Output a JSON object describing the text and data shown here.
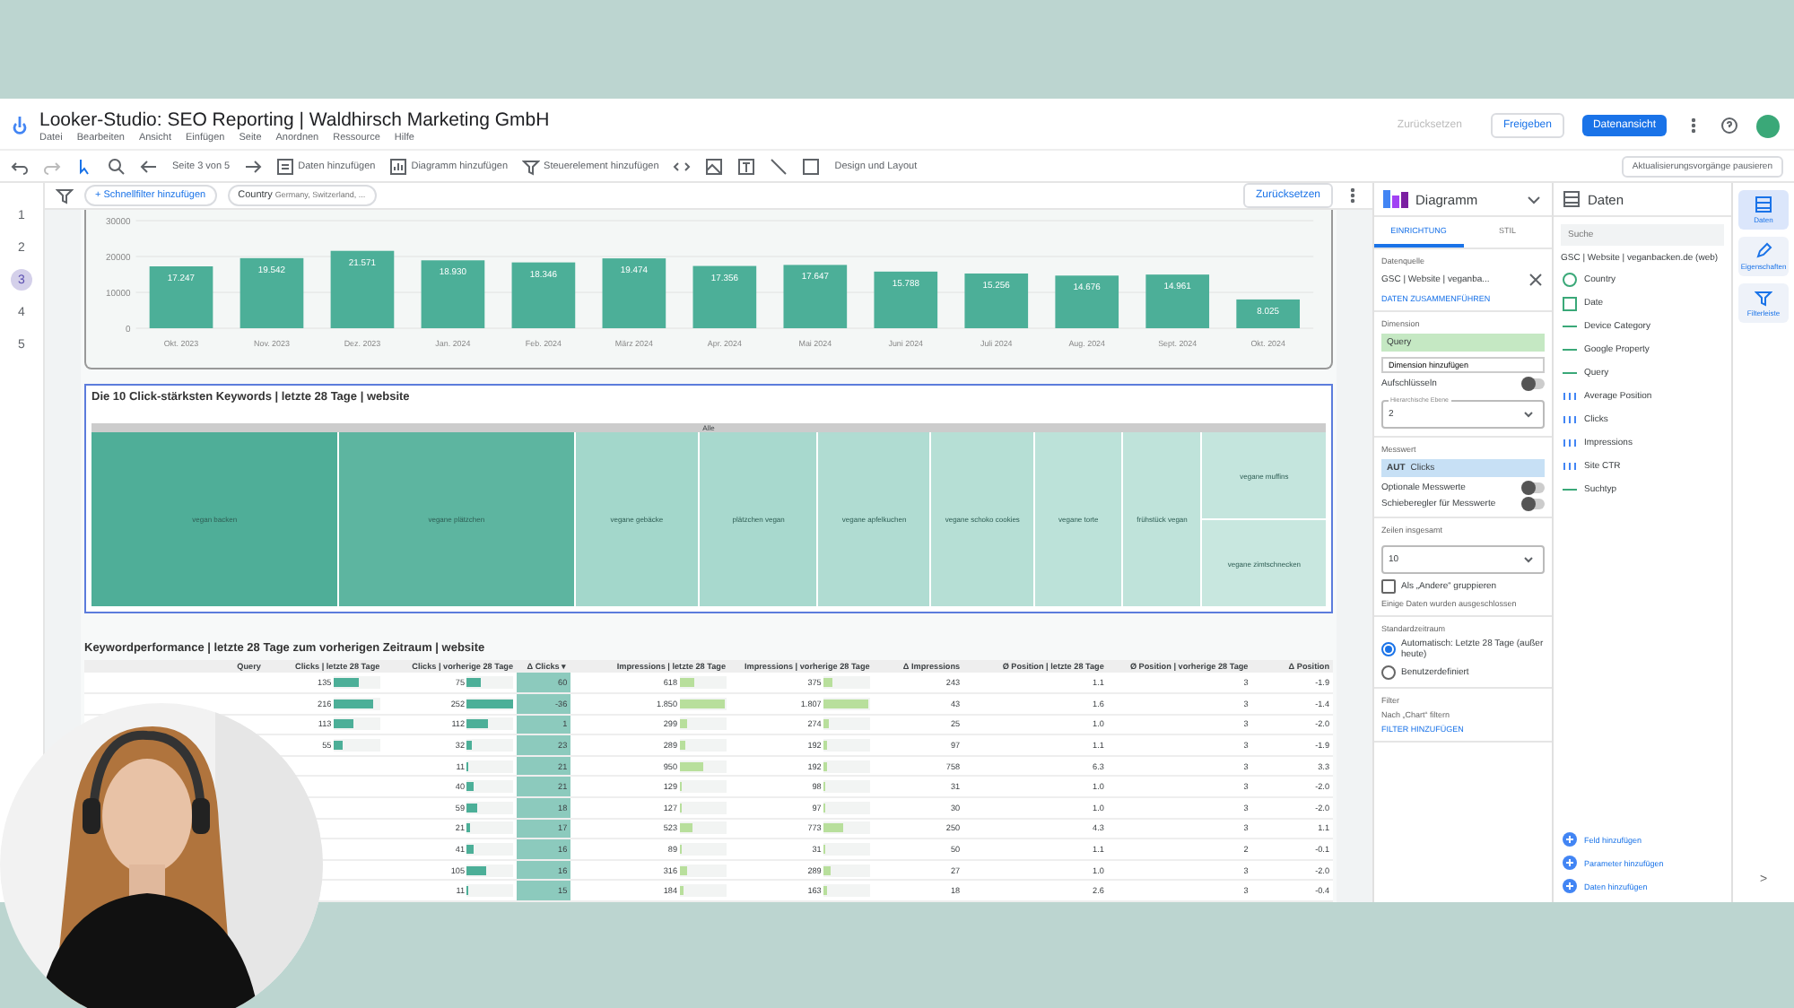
{
  "header": {
    "title": "Looker-Studio: SEO Reporting | Waldhirsch Marketing GmbH",
    "menu": [
      "Datei",
      "Bearbeiten",
      "Ansicht",
      "Einfügen",
      "Seite",
      "Anordnen",
      "Ressource",
      "Hilfe"
    ],
    "reset_button": {
      "label": "Zurücksetzen",
      "disabled": true
    },
    "share_button": "Freigeben",
    "view_button": "Datenansicht"
  },
  "toolbar": {
    "page_indicator": "Seite 3 von 5",
    "items": [
      {
        "label": "Daten hinzufügen",
        "kind": "data"
      },
      {
        "label": "Diagramm hinzufügen",
        "kind": "chart"
      },
      {
        "label": "Steuerelement hinzufügen",
        "kind": "control"
      }
    ],
    "theme_button": "Design und Layout",
    "pause_button": "Aktualisierungsvorgänge pausieren"
  },
  "pages": [
    {
      "label": "1",
      "selected": false
    },
    {
      "label": "2",
      "selected": false
    },
    {
      "label": "3",
      "selected": true
    },
    {
      "label": "4",
      "selected": false
    },
    {
      "label": "5",
      "selected": false
    }
  ],
  "filter_bar": {
    "add_filter": "+ Schnellfilter hinzufügen",
    "chip": {
      "label": "Country",
      "value": "Germany, Switzerland, ..."
    },
    "reset": "Zurücksetzen"
  },
  "bar_chart": {
    "chart_data": {
      "type": "bar",
      "categories": [
        "Okt. 2023",
        "Nov. 2023",
        "Dez. 2023",
        "Jan. 2024",
        "Feb. 2024",
        "März 2024",
        "Apr. 2024",
        "Mai 2024",
        "Juni 2024",
        "Juli 2024",
        "Aug. 2024",
        "Sept. 2024",
        "Okt. 2024"
      ],
      "series": [
        {
          "color": "#4caf98",
          "values": [
            17247,
            19542,
            21571,
            18930,
            18346,
            19474,
            17356,
            17647,
            15788,
            15256,
            14676,
            14961,
            8025
          ]
        }
      ],
      "value_labels": [
        "17.247",
        "19.542",
        "21.571",
        "18.930",
        "18.346",
        "19.474",
        "17.356",
        "17.647",
        "15.788",
        "15.256",
        "14.676",
        "14.961",
        "8.025"
      ],
      "ylim": [
        0,
        30000
      ],
      "yticks": [
        0,
        10000,
        20000,
        30000
      ]
    }
  },
  "treemap": {
    "title": "Die 10 Click-stärksten Keywords | letzte 28 Tage | website",
    "root": "Alle",
    "cells": [
      {
        "label": "vegan backen",
        "color": "#4fae98"
      },
      {
        "label": "vegane plätzchen",
        "color": "#5db5a0"
      },
      {
        "label": "vegane gebäcke",
        "color": "#a3d7cb"
      },
      {
        "label": "plätzchen vegan",
        "color": "#a8d9ce"
      },
      {
        "label": "vegane apfelkuchen",
        "color": "#b0dcd2"
      },
      {
        "label": "vegane schoko cookies",
        "color": "#b6dfd5"
      },
      {
        "label": "vegane torte",
        "color": "#bce2d9"
      },
      {
        "label": "frühstück vegan",
        "color": "#bfe3da"
      },
      {
        "label": "vegane muffins",
        "color": "#c4e5dd"
      },
      {
        "label": "vegane zimtschnecken",
        "color": "#c8e7df"
      }
    ]
  },
  "table": {
    "title": "Keywordperformance | letzte 28 Tage zum vorherigen Zeitraum | website",
    "columns": [
      "Query",
      "Clicks | letzte 28 Tage",
      "Clicks | vorherige 28 Tage",
      "Δ Clicks ▾",
      "Impressions | letzte 28 Tage",
      "Impressions | vorherige 28 Tage",
      "Δ Impressions",
      "Ø Position | letzte 28 Tage",
      "Ø Position | vorherige 28 Tage",
      "Δ Position"
    ],
    "rows": [
      [
        null,
        {
          "text": "135",
          "level": 0.54
        },
        {
          "text": "75",
          "level": 0.3
        },
        "60",
        {
          "text": "618",
          "level": 0.33
        },
        {
          "text": "375",
          "level": 0.2
        },
        "243",
        "1.1",
        "3",
        "-1.9"
      ],
      [
        null,
        {
          "text": "216",
          "level": 0.86
        },
        {
          "text": "252",
          "level": 1
        },
        "-36",
        {
          "text": "1.850",
          "level": 0.97
        },
        {
          "text": "1.807",
          "level": 0.95
        },
        "43",
        "1.6",
        "3",
        "-1.4"
      ],
      [
        null,
        {
          "text": "113",
          "level": 0.45
        },
        {
          "text": "112",
          "level": 0.45
        },
        "1",
        {
          "text": "299",
          "level": 0.16
        },
        {
          "text": "274",
          "level": 0.14
        },
        "25",
        "1.0",
        "3",
        "-2.0"
      ],
      [
        null,
        {
          "text": "55",
          "level": 0.22
        },
        {
          "text": "32",
          "level": 0.13
        },
        "23",
        {
          "text": "289",
          "level": 0.15
        },
        {
          "text": "192",
          "level": 0.1
        },
        "97",
        "1.1",
        "3",
        "-1.9"
      ],
      [
        null,
        null,
        {
          "text": "11",
          "level": 0.04
        },
        "21",
        {
          "text": "950",
          "level": 0.5
        },
        {
          "text": "192",
          "level": 0.1
        },
        "758",
        "6.3",
        "3",
        "3.3"
      ],
      [
        null,
        null,
        {
          "text": "40",
          "level": 0.16
        },
        "21",
        {
          "text": "129",
          "level": 0.07
        },
        {
          "text": "98",
          "level": 0.05
        },
        "31",
        "1.0",
        "3",
        "-2.0"
      ],
      [
        null,
        null,
        {
          "text": "59",
          "level": 0.23
        },
        "18",
        {
          "text": "127",
          "level": 0.07
        },
        {
          "text": "97",
          "level": 0.05
        },
        "30",
        "1.0",
        "3",
        "-2.0"
      ],
      [
        null,
        null,
        {
          "text": "21",
          "level": 0.08
        },
        "17",
        {
          "text": "523",
          "level": 0.28
        },
        {
          "text": "773",
          "level": 0.41
        },
        "250",
        "4.3",
        "3",
        "1.1"
      ],
      [
        null,
        null,
        {
          "text": "41",
          "level": 0.16
        },
        "16",
        {
          "text": "89",
          "level": 0.05
        },
        {
          "text": "31",
          "level": 0.02
        },
        "50",
        "1.1",
        "2",
        "-0.1"
      ],
      [
        null,
        null,
        {
          "text": "105",
          "level": 0.42
        },
        "16",
        {
          "text": "316",
          "level": 0.17
        },
        {
          "text": "289",
          "level": 0.15
        },
        "27",
        "1.0",
        "3",
        "-2.0"
      ],
      [
        null,
        null,
        {
          "text": "11",
          "level": 0.04
        },
        "15",
        {
          "text": "184",
          "level": 0.1
        },
        {
          "text": "163",
          "level": 0.09
        },
        "18",
        "2.6",
        "3",
        "-0.4"
      ]
    ]
  },
  "chart_panel": {
    "title": "Diagramm",
    "tabs": [
      {
        "label": "EINRICHTUNG",
        "selected": true
      },
      {
        "label": "STIL",
        "selected": false
      }
    ],
    "source_label": "Datenquelle",
    "source": "GSC | Website | veganba...",
    "blend": "DATEN ZUSAMMENFÜHREN",
    "dimension_label": "Dimension",
    "dimension": "Query",
    "add_dimension": "Dimension hinzufügen",
    "drilldown": {
      "label": "Aufschlüsseln",
      "on": false
    },
    "hierarchy": {
      "label": "Hierarchische Ebene",
      "value": "2"
    },
    "metric_label": "Messwert",
    "metric_chip": "AUT",
    "metric": "Clicks",
    "toggles": [
      {
        "label": "Optionale Messwerte",
        "on": false
      },
      {
        "label": "Schieberegler für Messwerte",
        "on": false
      }
    ],
    "rows_label": "Zeilen insgesamt",
    "rows_value": "10",
    "group_other": {
      "label": "Als „Andere“ gruppieren",
      "checked": false
    },
    "excluded_note": "Einige Daten wurden ausgeschlossen",
    "range_label": "Standardzeitraum",
    "ranges": [
      {
        "label": "Automatisch: Letzte 28 Tage (außer heute)",
        "selected": true
      },
      {
        "label": "Benutzerdefiniert",
        "selected": false
      }
    ],
    "filter_label": "Filter",
    "filter_sub": "Nach „Chart“ filtern",
    "add_filter": "FILTER HINZUFÜGEN"
  },
  "data_panel": {
    "title": "Daten",
    "search_placeholder": "Suche",
    "source": "GSC | Website | veganbacken.de (web)",
    "fields": [
      {
        "label": "Country",
        "kind": "geo"
      },
      {
        "label": "Date",
        "kind": "date"
      },
      {
        "label": "Device Category",
        "kind": "text"
      },
      {
        "label": "Google Property",
        "kind": "text"
      },
      {
        "label": "Query",
        "kind": "text"
      },
      {
        "label": "Average Position",
        "kind": "number"
      },
      {
        "label": "Clicks",
        "kind": "number"
      },
      {
        "label": "Impressions",
        "kind": "number"
      },
      {
        "label": "Site CTR",
        "kind": "number"
      },
      {
        "label": "Suchtyp",
        "kind": "text"
      }
    ],
    "add_field": "Feld hinzufügen",
    "add_parameter": "Parameter hinzufügen",
    "add_data": "Daten hinzufügen"
  },
  "rail": [
    {
      "label": "Daten",
      "kind": "data",
      "selected": true
    },
    {
      "label": "Eigenschaften",
      "kind": "properties",
      "selected": false
    },
    {
      "label": "Filterleiste",
      "kind": "filter",
      "selected": false
    }
  ],
  "rail_expand": ">"
}
